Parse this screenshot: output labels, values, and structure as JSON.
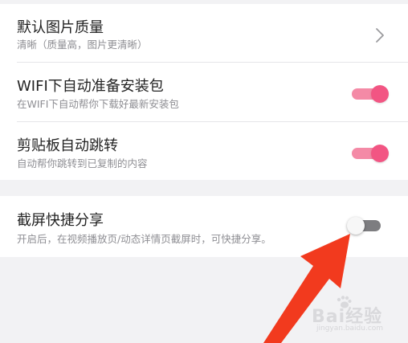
{
  "settings": {
    "image_quality": {
      "title": "默认图片质量",
      "subtitle": "清晰（质量高，图片更清晰）"
    },
    "wifi_prepare": {
      "title": "WIFI下自动准备安装包",
      "subtitle": "在WIFI下自动帮你下载好最新安装包",
      "enabled": true
    },
    "clipboard_jump": {
      "title": "剪贴板自动跳转",
      "subtitle": "自动帮你跳转到已复制的内容",
      "enabled": true
    },
    "screenshot_share": {
      "title": "截屏快捷分享",
      "subtitle": "开启后，在视频播放页/动态详情页截屏时，可快捷分享。",
      "enabled": false
    }
  },
  "colors": {
    "accent_pink": "#f25583",
    "arrow_red": "#f23a1e"
  },
  "watermark": {
    "text": "Bai经验",
    "sub": "jingyan.baidu.com"
  }
}
